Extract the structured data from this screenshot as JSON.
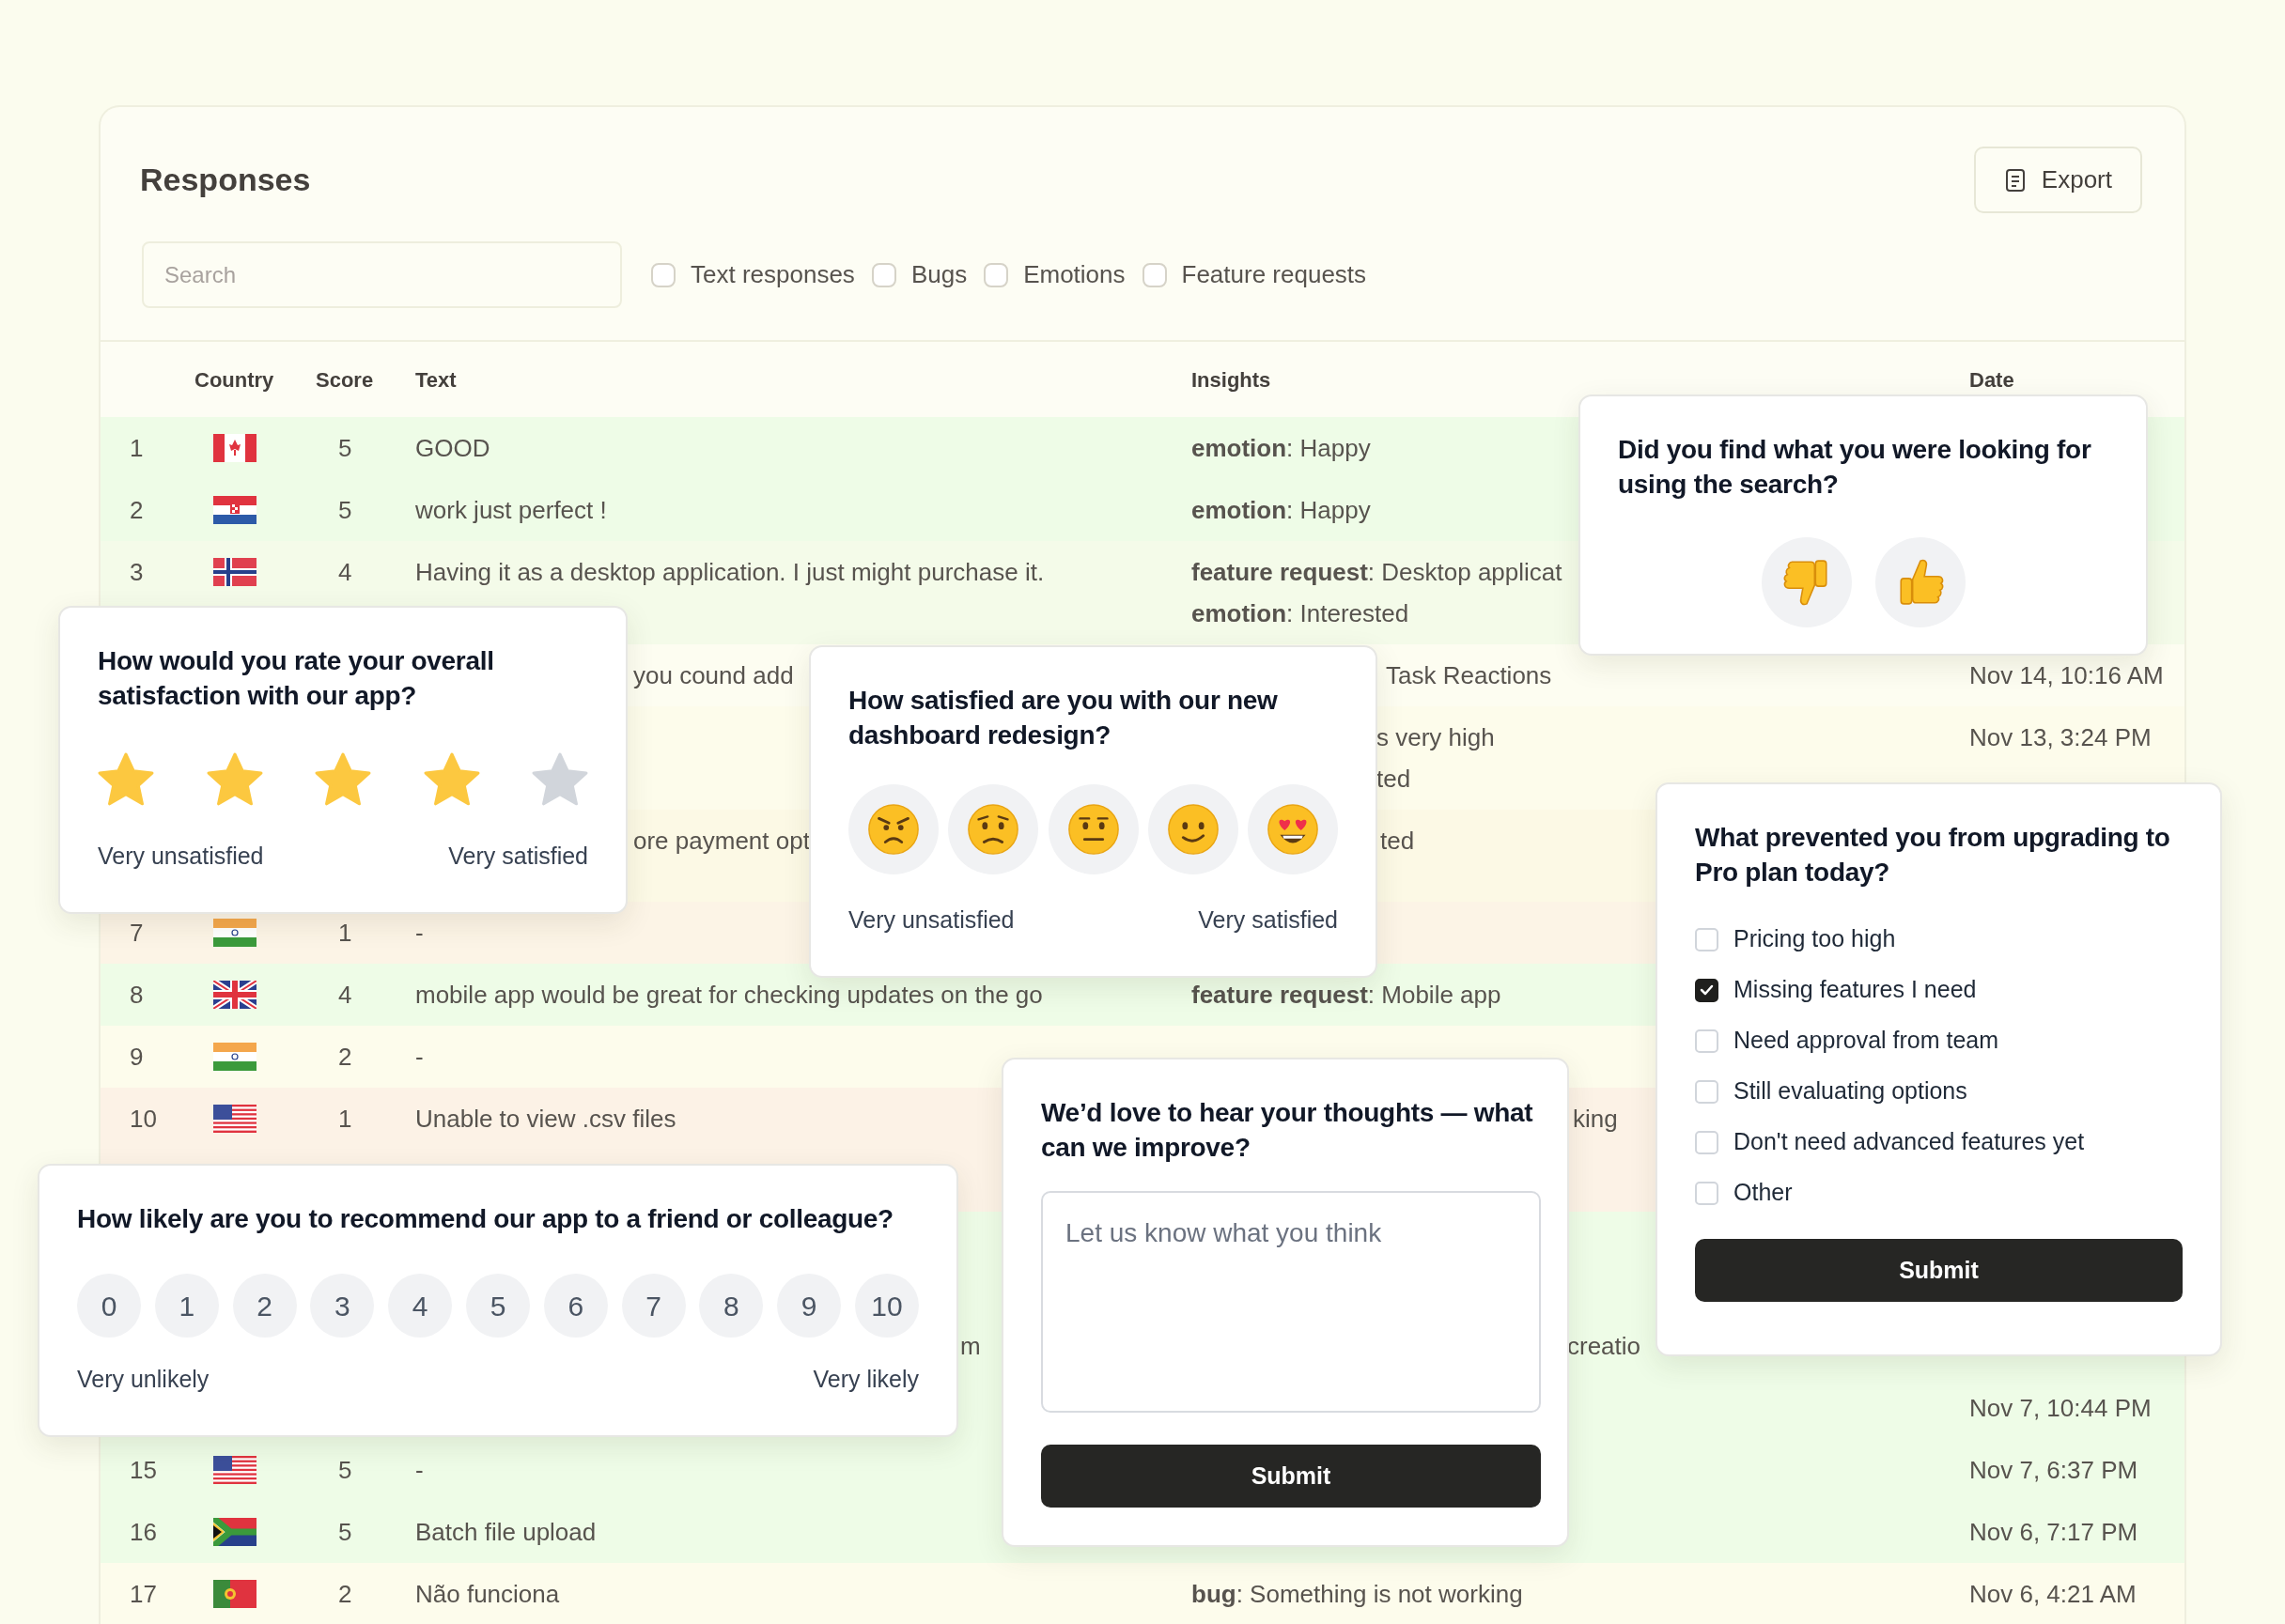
{
  "panel": {
    "title": "Responses",
    "export_button": "Export"
  },
  "filters": {
    "search": {
      "placeholder": "Search"
    },
    "options": [
      {
        "label": "Text responses",
        "checked": false
      },
      {
        "label": "Bugs",
        "checked": false
      },
      {
        "label": "Emotions",
        "checked": false
      },
      {
        "label": "Feature requests",
        "checked": false
      }
    ]
  },
  "table": {
    "columns": [
      "Country",
      "Score",
      "Text",
      "Insights",
      "Date"
    ],
    "rows": [
      {
        "number": "1",
        "kind": "ca",
        "score": "5",
        "text": "GOOD",
        "insights": [
          "**emotion**: Happy"
        ],
        "color": "#eefce7"
      },
      {
        "number": "2",
        "kind": "hr",
        "score": "5",
        "text": "work just perfect !",
        "insights": [
          "**emotion**: Happy"
        ],
        "color": "#eefce7"
      },
      {
        "number": "3",
        "kind": "no",
        "score": "4",
        "text": "Having it as a desktop application. I just might purchase it.",
        "insights": [
          "**feature request**: Desktop applicat",
          "**emotion**: Interested"
        ],
        "color": "#f4fbe9"
      },
      {
        "text": "you cound add",
        "insights": [
          "Task Reactions"
        ],
        "date": "Nov 14, 10:16 AM",
        "color": "#fdfdf1"
      },
      {
        "insights": [
          "s very high",
          "ted"
        ],
        "date": "Nov 13, 3:24 PM",
        "color": "#fdfceb"
      },
      {
        "text": "ore payment opt",
        "insights": [
          "ted"
        ],
        "color": "#fcf9e5"
      },
      {
        "number": "7",
        "kind": "in",
        "score": "1",
        "text": "-",
        "color": "#fcf4e6"
      },
      {
        "number": "8",
        "kind": "gb",
        "score": "4",
        "text": "mobile app would be great for checking updates on the go",
        "insights": [
          "**feature request**: Mobile app"
        ],
        "color": "#eefce7"
      },
      {
        "number": "9",
        "kind": "in",
        "score": "2",
        "text": "-",
        "color": "#fdfcec"
      },
      {
        "number": "10",
        "kind": "us",
        "score": "1",
        "text": "Unable to view .csv files",
        "insights": [
          "king"
        ],
        "color": "#fcf2e6"
      },
      {
        "color": "#fcf2e6"
      },
      {
        "color": "#eefce7"
      },
      {
        "text": "m",
        "insights": [
          "creatio"
        ],
        "color": "#eefce7"
      },
      {
        "date": "Nov 7, 10:44 PM",
        "color": "#eefce7"
      },
      {
        "number": "15",
        "kind": "us",
        "score": "5",
        "text": "-",
        "date": "Nov 7, 6:37 PM",
        "color": "#eefce7"
      },
      {
        "number": "16",
        "kind": "za",
        "score": "5",
        "text": "Batch file upload",
        "date": "Nov 6, 7:17 PM",
        "color": "#eefce7"
      },
      {
        "number": "17",
        "kind": "pt",
        "score": "2",
        "text": "Não funciona",
        "insights": [
          "**bug**: Something is not working"
        ],
        "date": "Nov 6, 4:21 AM",
        "color": "#fdfcec"
      }
    ]
  },
  "surveys": [
    {
      "kind": "thumbs",
      "question": "Did you find what you were looking for using the search?"
    },
    {
      "kind": "stars",
      "question": "How would you rate your overall satisfaction with our app?",
      "stars": 4,
      "low_label": "Very unsatisfied",
      "high_label": "Very satisfied"
    },
    {
      "kind": "emoji",
      "question": "How satisfied are you with our new dashboard redesign?",
      "low_label": "Very unsatisfied",
      "high_label": "Very satisfied"
    },
    {
      "kind": "checkboxes",
      "question": "What prevented you from upgrading to Pro plan today?",
      "options": [
        {
          "label": "Pricing too high",
          "checked": false
        },
        {
          "label": "Missing features I need",
          "checked": true
        },
        {
          "label": "Need approval from team",
          "checked": false
        },
        {
          "label": "Still evaluating options",
          "checked": false
        },
        {
          "label": "Don't need advanced features yet",
          "checked": false
        },
        {
          "label": "Other",
          "checked": false
        }
      ],
      "submit": "Submit"
    },
    {
      "kind": "scale",
      "question": "How likely are you to recommend our app to a friend or colleague?",
      "options": [
        "0",
        "1",
        "2",
        "3",
        "4",
        "5",
        "6",
        "7",
        "8",
        "9",
        "10"
      ],
      "low_label": "Very unlikely",
      "high_label": "Very likely"
    },
    {
      "kind": "text",
      "question": "We’d love to hear your thoughts — what can we improve?",
      "placeholder": "Let us know what you think",
      "submit": "Submit"
    }
  ]
}
